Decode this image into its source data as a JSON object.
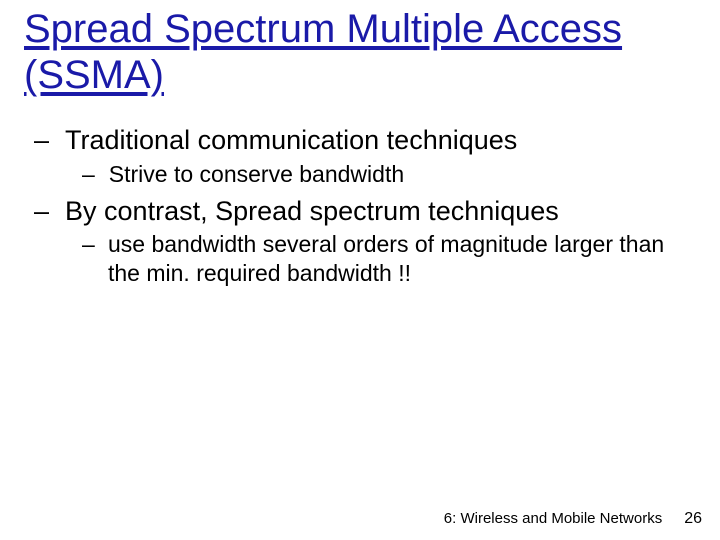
{
  "title": "Spread Spectrum Multiple Access (SSMA)",
  "bullets": {
    "b1": {
      "text": "Traditional communication techniques",
      "sub1": "Strive to conserve bandwidth"
    },
    "b2": {
      "text": "By contrast, Spread spectrum techniques",
      "sub1": "use bandwidth several orders of magnitude larger than the min. required bandwidth !!"
    }
  },
  "footer": {
    "section": "6: Wireless and Mobile Networks",
    "page": "26"
  }
}
